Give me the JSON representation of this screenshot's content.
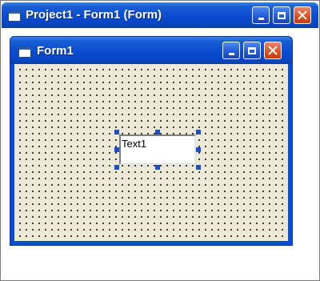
{
  "outer_window": {
    "title": "Project1 - Form1 (Form)",
    "icon": "form-icon",
    "buttons": [
      "minimize-icon",
      "maximize-icon",
      "close-icon"
    ]
  },
  "inner_window": {
    "title": "Form1",
    "icon": "form-icon",
    "buttons": [
      "minimize-icon",
      "maximize-icon",
      "close-icon"
    ]
  },
  "form": {
    "textbox_text": "Text1"
  },
  "colors": {
    "titlebar": "#0a4bcf",
    "form_background": "#ece9d8",
    "close_button": "#d9501f",
    "selection_handle": "#1f4ec4"
  }
}
